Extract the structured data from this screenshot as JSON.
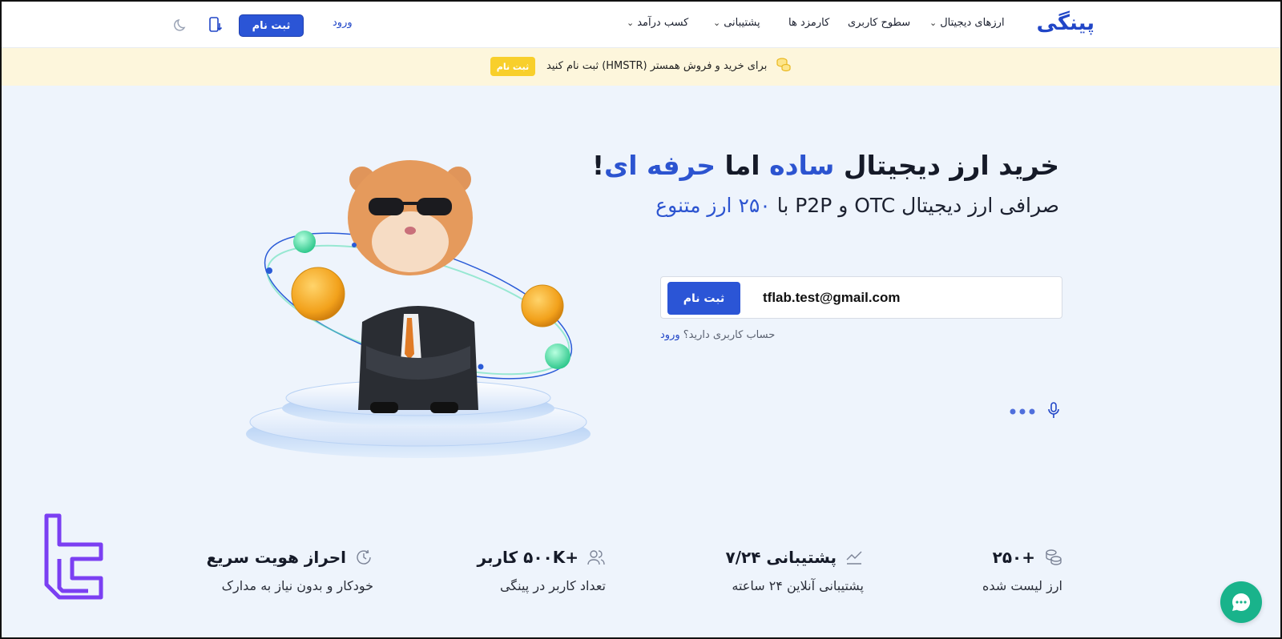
{
  "header": {
    "logo": "پینگی",
    "nav": [
      {
        "label": "ارزهای دیجیتال",
        "dropdown": true
      },
      {
        "label": "سطوح کاربری",
        "dropdown": false
      },
      {
        "label": "کارمزد ها",
        "dropdown": false
      },
      {
        "label": "پشتیبانی",
        "dropdown": true
      },
      {
        "label": "کسب درآمد",
        "dropdown": true
      }
    ],
    "login_label": "ورود",
    "signup_label": "ثبت نام",
    "icons": [
      "app-download-icon",
      "moon-icon"
    ]
  },
  "banner": {
    "text": "برای خرید و فروش همستر (HMSTR) ثبت نام کنید",
    "button": "ثبت نام",
    "color": "#fdf6dc",
    "button_color": "#f8cf2b"
  },
  "hero": {
    "title_part1": "خرید ارز دیجیتال ",
    "title_highlight1": "ساده",
    "title_part2": " اما ",
    "title_highlight2": "حرفه ای",
    "title_part3": "!",
    "subtitle_part1": "صرافی ارز دیجیتال OTC و P2P با ",
    "subtitle_highlight": "۲۵۰ ارز متنوع",
    "email_value": "tflab.test@gmail.com",
    "submit_label": "ثبت نام",
    "have_account": "حساب کاربری دارید؟",
    "login_link": "ورود",
    "accent": "#2c54d0"
  },
  "stats": [
    {
      "title": "+۲۵۰",
      "desc": "ارز لیست شده",
      "icon": "coins-icon"
    },
    {
      "title": "پشتیبانی ۷/۲۴",
      "desc": "پشتیبانی آنلاین ۲۴ ساعته",
      "icon": "chart-icon"
    },
    {
      "title": "+۵۰۰K کاربر",
      "desc": "تعداد کاربر در پینگی",
      "icon": "users-icon"
    },
    {
      "title": "احراز هویت سریع",
      "desc": "خودکار و بدون نیاز به مدارک",
      "icon": "clock-icon"
    }
  ]
}
